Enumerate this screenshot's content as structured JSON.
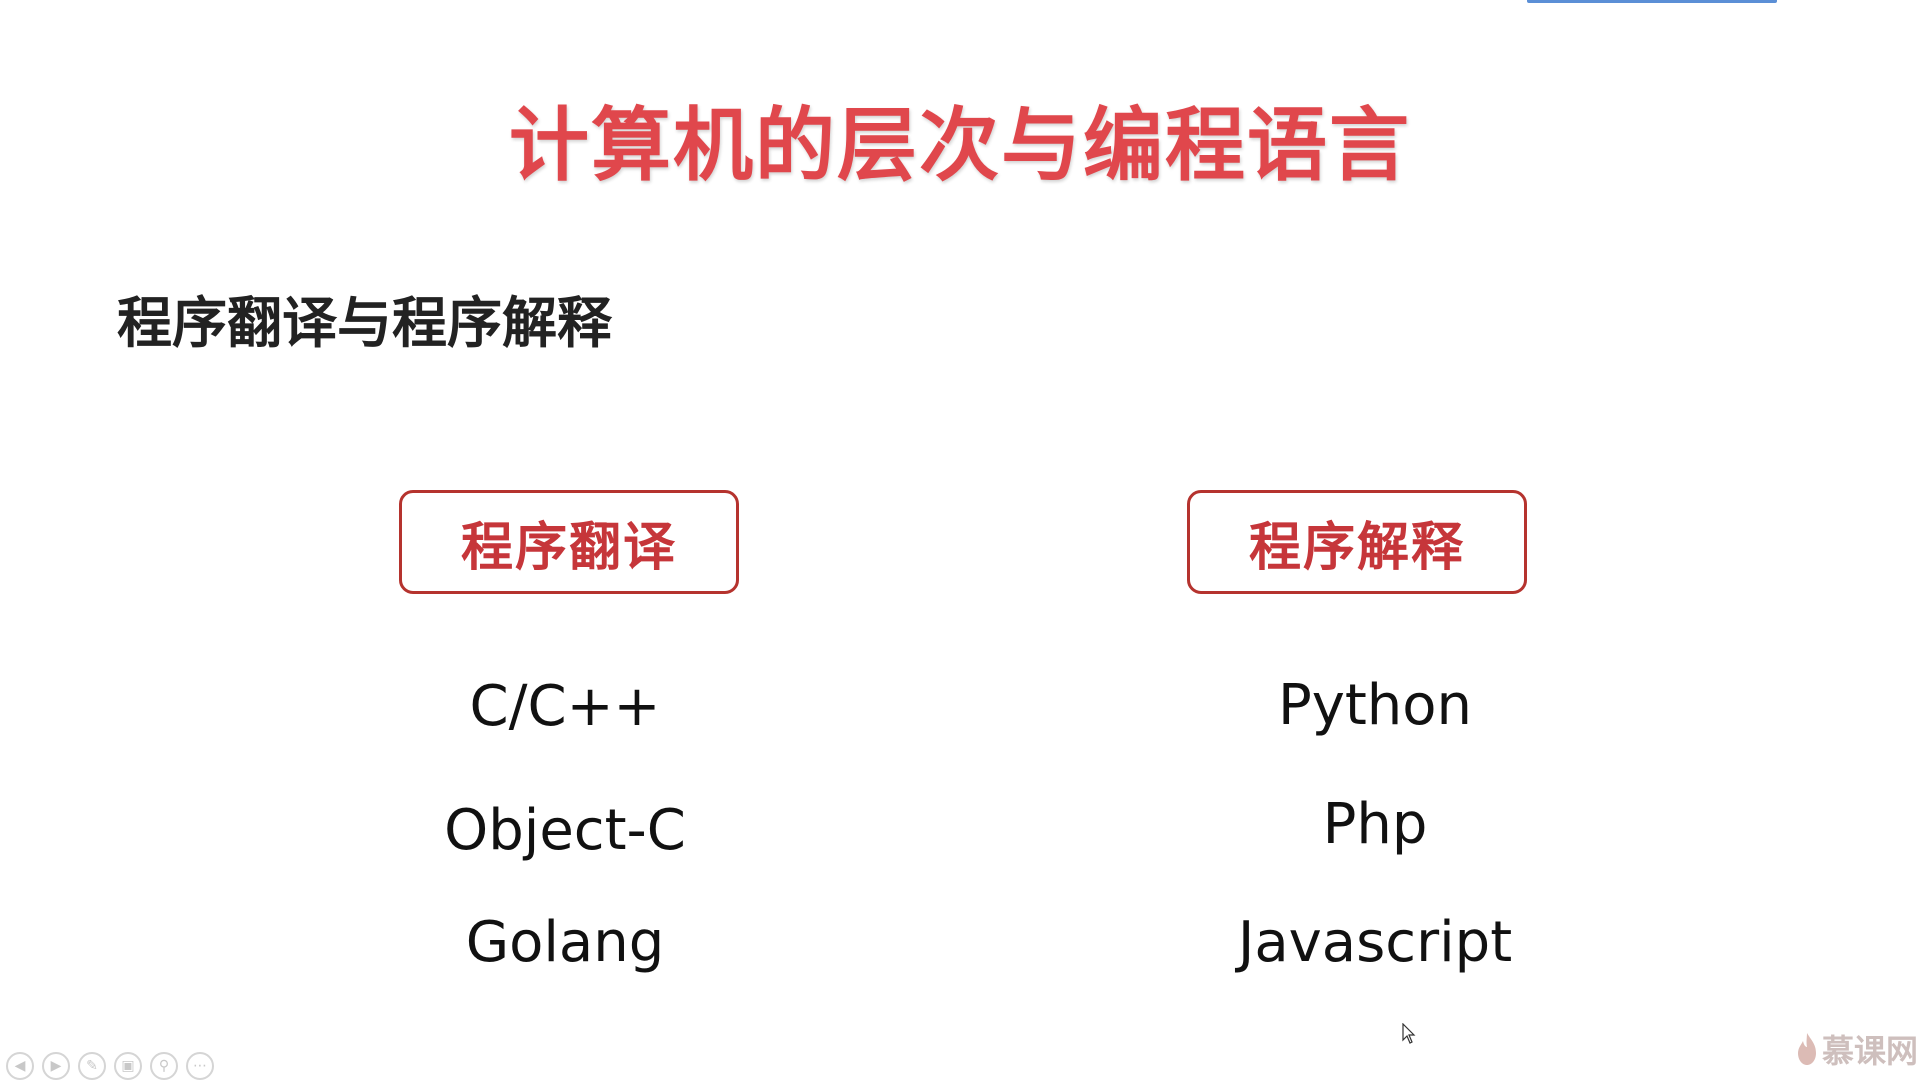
{
  "slide": {
    "title": "计算机的层次与编程语言",
    "subtitle": "程序翻译与程序解释",
    "columns": [
      {
        "heading": "程序翻译",
        "items": [
          "C/C++",
          "Object-C",
          "Golang"
        ]
      },
      {
        "heading": "程序解释",
        "items": [
          "Python",
          "Php",
          "Javascript"
        ]
      }
    ]
  },
  "controls": {
    "icons": [
      "prev-icon",
      "next-icon",
      "pen-icon",
      "pages-icon",
      "zoom-icon",
      "more-icon"
    ]
  },
  "watermark": {
    "text": "慕课网"
  },
  "colors": {
    "title": "#e0474c",
    "box_border": "#b5332e",
    "box_text": "#c6363a",
    "progress": "#5b8fd6"
  }
}
